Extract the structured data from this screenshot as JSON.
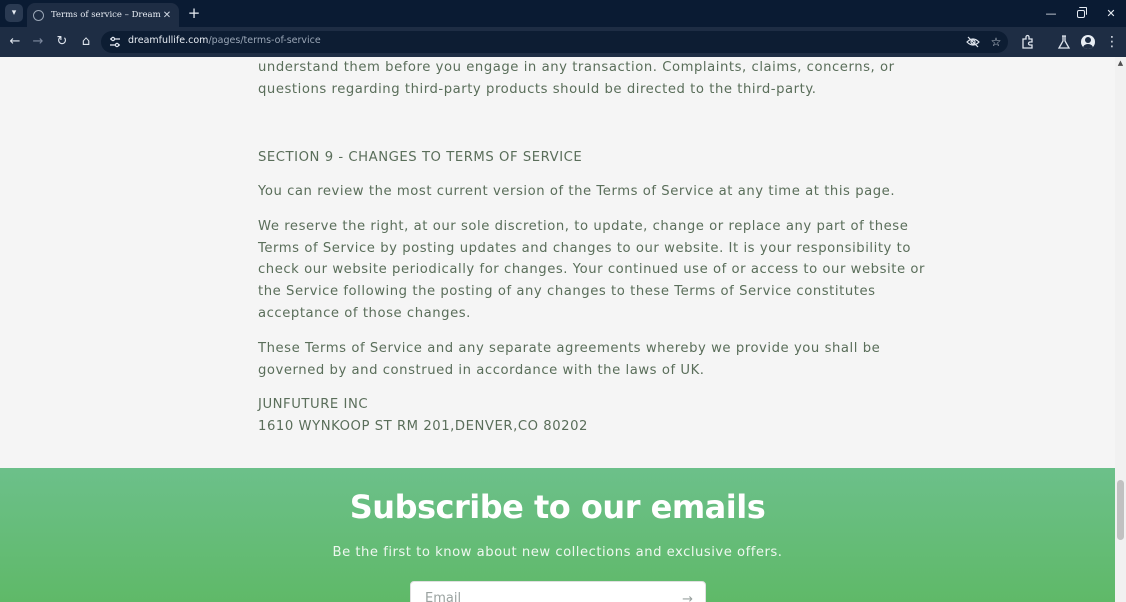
{
  "browser": {
    "tab_title": "Terms of service – Dreamfull.ife",
    "url_host": "dreamfullife.com",
    "url_path": "/pages/terms-of-service",
    "new_tab_symbol": "+",
    "tab_close_symbol": "✕"
  },
  "page": {
    "prev_lines": [
      "understand them before you engage in any transaction. Complaints, claims, concerns, or",
      "questions regarding third-party products should be directed to the third-party."
    ],
    "section_heading": "SECTION 9 - CHANGES TO TERMS OF SERVICE",
    "para1_lines": [
      "You can review the most current version of the Terms of Service at any time at this page."
    ],
    "para2_lines": [
      "We reserve the right, at our sole discretion, to update, change or replace any part of these",
      "Terms of Service by posting updates and changes to our website. It is your responsibility to",
      "check our website periodically for changes. Your continued use of or access to our website or",
      "the Service following the posting of any changes to these Terms of Service constitutes",
      "acceptance of those changes."
    ],
    "para3_lines": [
      "These Terms of Service and any separate agreements whereby we provide you shall be",
      "governed by and construed in accordance with the laws of UK."
    ],
    "company_name": "JUNFUTURE INC",
    "company_address": "1610 WYNKOOP ST RM 201,DENVER,CO 80202"
  },
  "subscribe": {
    "title": "Subscribe to our emails",
    "text": "Be the first to know about new collections and exclusive offers.",
    "email_placeholder": "Email"
  },
  "colors": {
    "body_text": "#5a6e5a",
    "page_bg": "#f5f5f5",
    "subscribe_bg": "#62bb72",
    "browser_frame": "#0a1b33"
  }
}
